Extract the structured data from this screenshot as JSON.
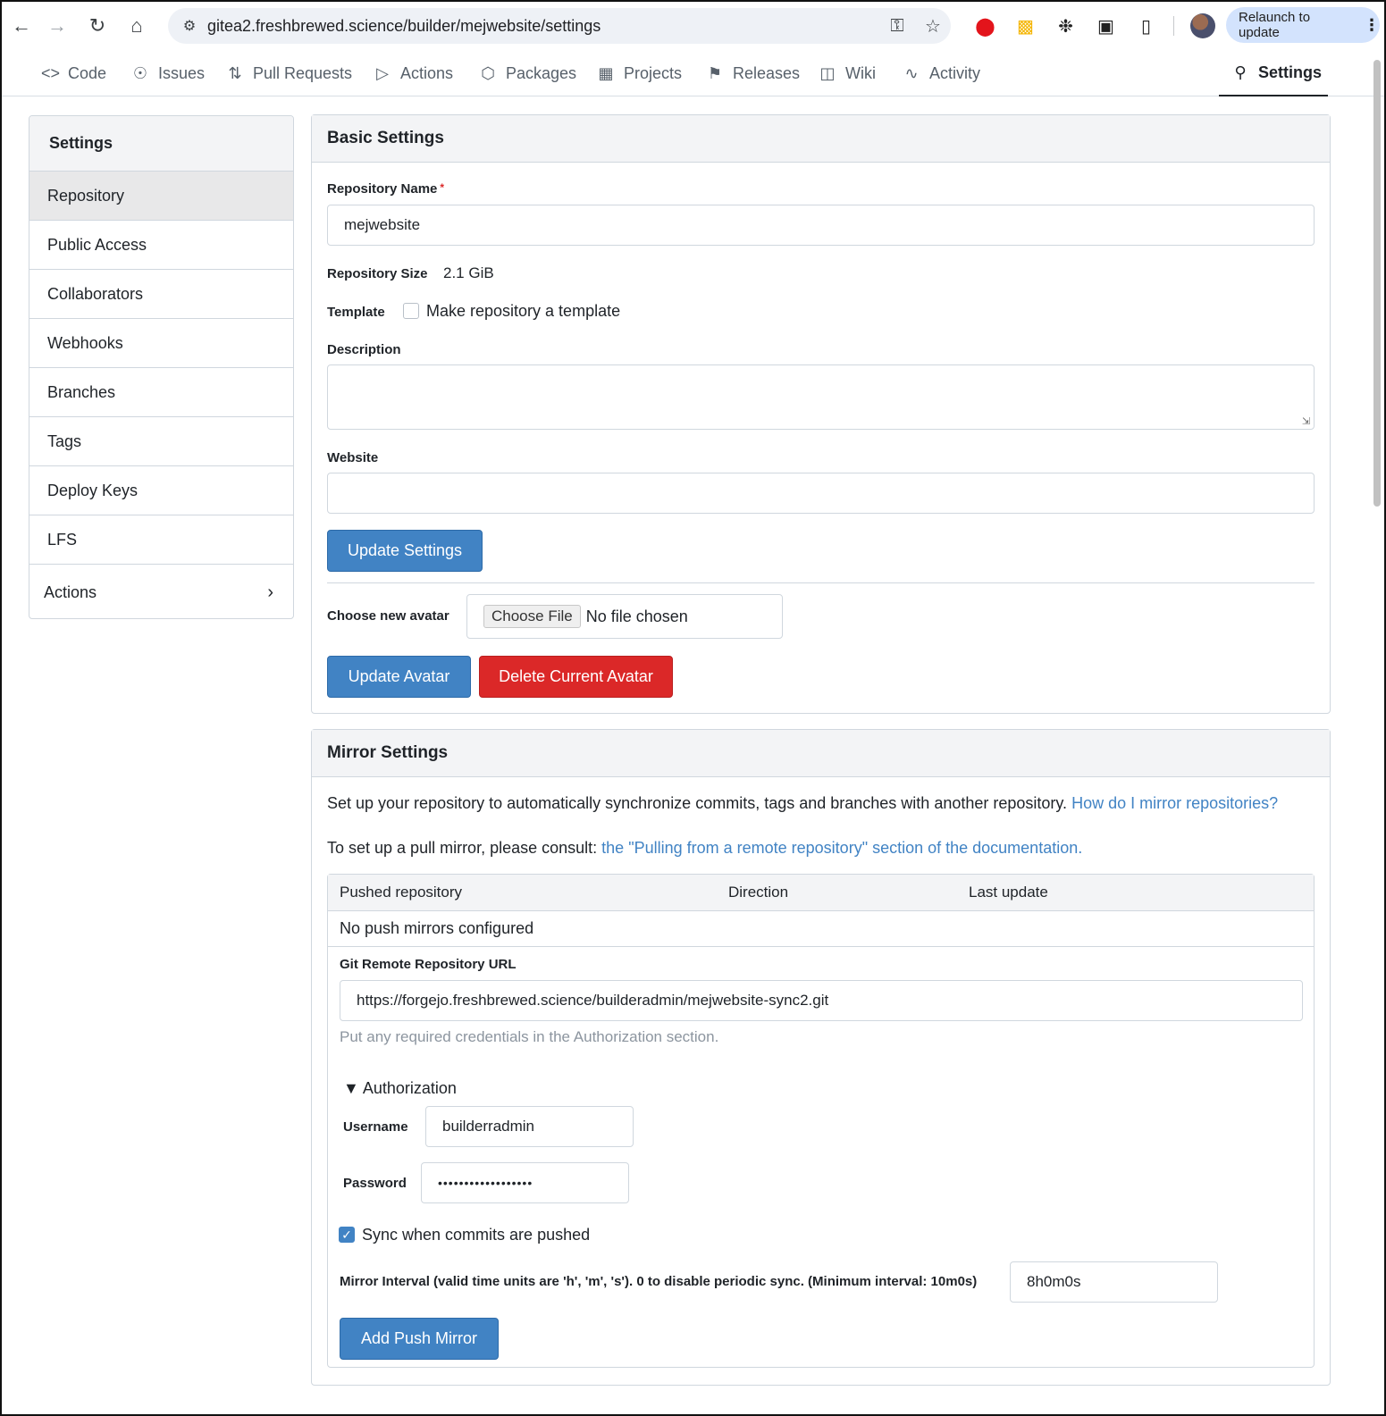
{
  "browser": {
    "url": "gitea2.freshbrewed.science/builder/mejwebsite/settings",
    "relaunch_label": "Relaunch to update"
  },
  "repo_tabs": [
    {
      "label": "Code",
      "icon": "code-icon"
    },
    {
      "label": "Issues",
      "icon": "issue-icon"
    },
    {
      "label": "Pull Requests",
      "icon": "pull-request-icon"
    },
    {
      "label": "Actions",
      "icon": "play-icon"
    },
    {
      "label": "Packages",
      "icon": "package-icon"
    },
    {
      "label": "Projects",
      "icon": "project-icon"
    },
    {
      "label": "Releases",
      "icon": "tag-icon"
    },
    {
      "label": "Wiki",
      "icon": "book-icon"
    },
    {
      "label": "Activity",
      "icon": "pulse-icon"
    },
    {
      "label": "Settings",
      "icon": "tool-icon",
      "active": true
    }
  ],
  "sidebar": {
    "title": "Settings",
    "items": [
      {
        "label": "Repository",
        "active": true
      },
      {
        "label": "Public Access"
      },
      {
        "label": "Collaborators"
      },
      {
        "label": "Webhooks"
      },
      {
        "label": "Branches"
      },
      {
        "label": "Tags"
      },
      {
        "label": "Deploy Keys"
      },
      {
        "label": "LFS"
      },
      {
        "label": "Actions",
        "has_submenu": true
      }
    ]
  },
  "basic": {
    "title": "Basic Settings",
    "repo_name_label": "Repository Name",
    "required_mark": "*",
    "repo_name_value": "mejwebsite",
    "repo_size_label": "Repository Size",
    "repo_size_value": "2.1 GiB",
    "template_label": "Template",
    "template_checkbox_label": "Make repository a template",
    "template_checked": false,
    "description_label": "Description",
    "description_value": "",
    "website_label": "Website",
    "website_value": "",
    "update_settings_label": "Update Settings",
    "avatar_label": "Choose new avatar",
    "choose_file_label": "Choose File",
    "no_file_label": "No file chosen",
    "update_avatar_label": "Update Avatar",
    "delete_avatar_label": "Delete Current Avatar"
  },
  "mirror": {
    "title": "Mirror Settings",
    "intro": "Set up your repository to automatically synchronize commits, tags and branches with another repository.",
    "intro_link": "How do I mirror repositories?",
    "pull_text": "To set up a pull mirror, please consult:",
    "pull_link": "the \"Pulling from a remote repository\" section of the documentation.",
    "columns": [
      "Pushed repository",
      "Direction",
      "Last update"
    ],
    "empty_text": "No push mirrors configured",
    "remote_url_label": "Git Remote Repository URL",
    "remote_url_value": "https://forgejo.freshbrewed.science/builderadmin/mejwebsite-sync2.git",
    "remote_url_help": "Put any required credentials in the Authorization section.",
    "auth_toggle": "▼ Authorization",
    "username_label": "Username",
    "username_value": "builderradmin",
    "password_label": "Password",
    "password_value": "••••••••••••••••••",
    "sync_label": "Sync when commits are pushed",
    "sync_checked": true,
    "interval_label": "Mirror Interval (valid time units are 'h', 'm', 's'). 0 to disable periodic sync. (Minimum interval: 10m0s)",
    "interval_value": "8h0m0s",
    "add_button_label": "Add Push Mirror"
  }
}
